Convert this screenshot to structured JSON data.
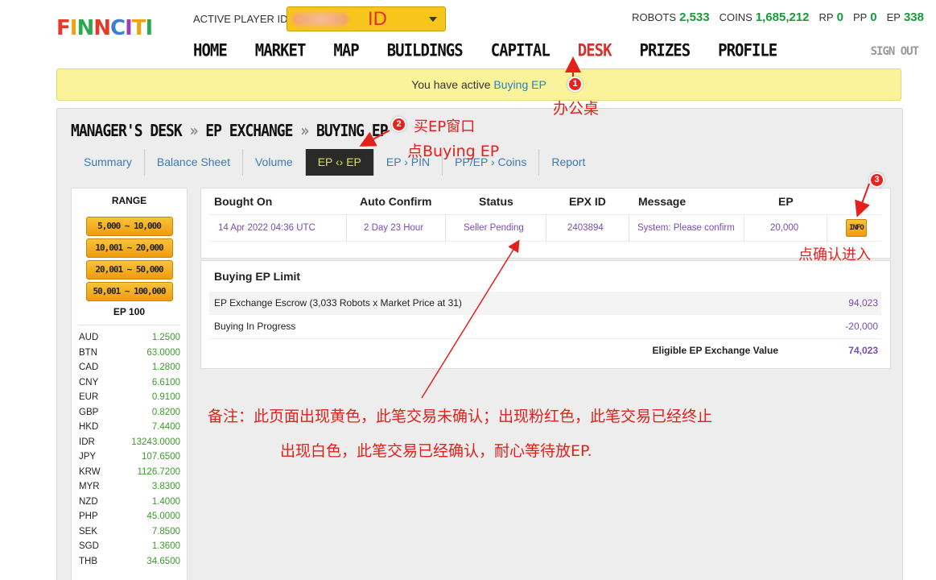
{
  "header": {
    "logo_text": "FINNCITI",
    "active_player_label": "ACTIVE PLAYER ID",
    "player_id_value": "ID",
    "stats": [
      {
        "label": "ROBOTS",
        "value": "2,533"
      },
      {
        "label": "COINS",
        "value": "1,685,212"
      },
      {
        "label": "RP",
        "value": "0"
      },
      {
        "label": "PP",
        "value": "0"
      },
      {
        "label": "EP",
        "value": "338"
      }
    ],
    "nav": [
      "HOME",
      "MARKET",
      "MAP",
      "BUILDINGS",
      "CAPITAL",
      "DESK",
      "PRIZES",
      "PROFILE"
    ],
    "active_nav": "DESK",
    "signout": "SIGN OUT"
  },
  "alert": {
    "prefix": "You have active ",
    "link": "Buying EP"
  },
  "breadcrumb": {
    "part1": "MANAGER'S DESK",
    "sep": "»",
    "part2": "EP EXCHANGE",
    "part3": "BUYING EP"
  },
  "tabs": [
    "Summary",
    "Balance Sheet",
    "Volume",
    "EP ‹› EP",
    "EP › PIN",
    "PP/EP › Coins",
    "Report"
  ],
  "sidebar": {
    "range_title": "RANGE",
    "ranges": [
      "5,000 ~ 10,000",
      "10,001 ~ 20,000",
      "20,001 ~ 50,000",
      "50,001 ~ 100,000"
    ],
    "ep_label": "EP 100",
    "currencies": [
      {
        "code": "AUD",
        "value": "1.2500"
      },
      {
        "code": "BTN",
        "value": "63.0000"
      },
      {
        "code": "CAD",
        "value": "1.2800"
      },
      {
        "code": "CNY",
        "value": "6.6100"
      },
      {
        "code": "EUR",
        "value": "0.9100"
      },
      {
        "code": "GBP",
        "value": "0.8200"
      },
      {
        "code": "HKD",
        "value": "7.4400"
      },
      {
        "code": "IDR",
        "value": "13243.0000"
      },
      {
        "code": "JPY",
        "value": "107.6500"
      },
      {
        "code": "KRW",
        "value": "1126.7200"
      },
      {
        "code": "MYR",
        "value": "3.8300"
      },
      {
        "code": "NZD",
        "value": "1.4000"
      },
      {
        "code": "PHP",
        "value": "45.0000"
      },
      {
        "code": "SEK",
        "value": "7.8500"
      },
      {
        "code": "SGD",
        "value": "1.3600"
      },
      {
        "code": "THB",
        "value": "34.6500"
      }
    ]
  },
  "orders": {
    "headers": {
      "bought_on": "Bought On",
      "auto_confirm": "Auto Confirm",
      "status": "Status",
      "epx_id": "EPX ID",
      "message": "Message",
      "ep": "EP"
    },
    "row": {
      "bought_on": "14 Apr 2022  04:36 UTC",
      "auto_confirm": "2 Day 23 Hour",
      "status": "Seller Pending",
      "epx_id": "2403894",
      "message": "System: Please confirm",
      "ep": "20,000",
      "info_label": "INFO"
    }
  },
  "limit": {
    "title": "Buying EP Limit",
    "rows": [
      {
        "label": "EP Exchange Escrow (3,033 Robots x Market Price at 31)",
        "value": "94,023"
      },
      {
        "label": "Buying In Progress",
        "value": "-20,000"
      }
    ],
    "total_label": "Eligible EP Exchange Value",
    "total_value": "74,023"
  },
  "annotations": {
    "badge1": "1",
    "badge2": "2",
    "badge3": "3",
    "note1": "办公桌",
    "note2a": "买EP窗口",
    "note2b": "点Buying EP",
    "note3": "点确认进入",
    "remark_line1": "备注：此页面出现黄色，此笔交易未确认；出现粉红色，此笔交易已经终止",
    "remark_line2": "出现白色，此笔交易已经确认，耐心等待放EP."
  },
  "colors": {
    "accent_red": "#d3322f",
    "stat_green": "#1a9a3a",
    "alert_yellow": "#faf39a",
    "tab_active_bg": "#2a2a2a",
    "tab_active_text": "#d7e64a",
    "purple_text": "#7a4cb3",
    "button_gold": "#f7c51c",
    "annotation_red": "#e3201b"
  }
}
